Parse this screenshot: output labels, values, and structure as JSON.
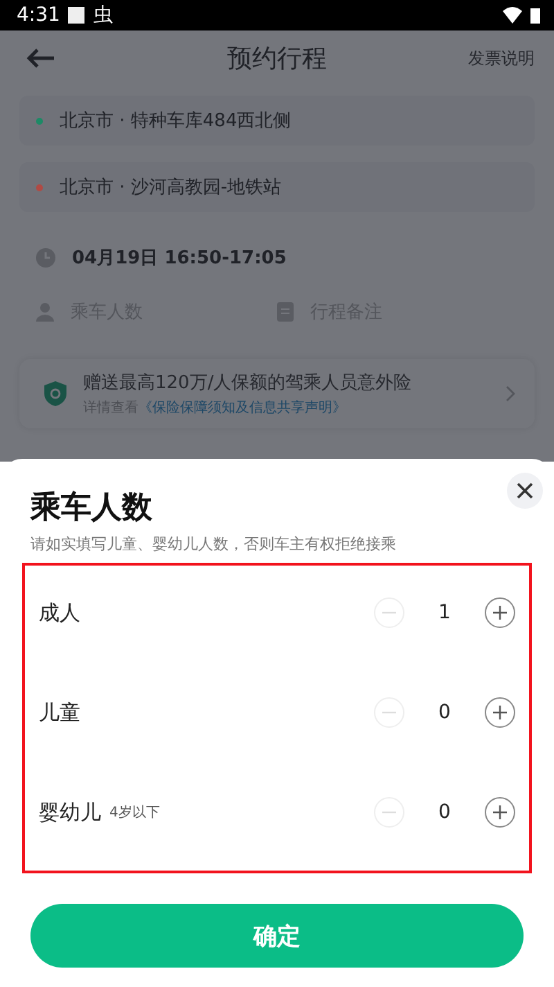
{
  "status_bar": {
    "time": "4:31",
    "notification": "虫"
  },
  "header": {
    "title": "预约行程",
    "action": "发票说明"
  },
  "route": [
    {
      "text": "北京市 · 特种车库484西北侧",
      "color": "#1d8a66"
    },
    {
      "text": "北京市 · 沙河高教园-地铁站",
      "color": "#b04a44"
    }
  ],
  "time": "04月19日 16:50-17:05",
  "fields": [
    {
      "placeholder": "乘车人数",
      "kind": "person"
    },
    {
      "placeholder": "行程备注",
      "kind": "note"
    }
  ],
  "insurance": {
    "title": "赠送最高120万/人保额的驾乘人员意外险",
    "detail": "详情查看",
    "link": "《保险保障须知及信息共享声明》"
  },
  "sheet": {
    "title": "乘车人数",
    "subtitle": "请如实填写儿童、婴幼儿人数，否则车主有权拒绝接乘",
    "rows": [
      {
        "label": "成人",
        "count": "1",
        "minus_disabled": true
      },
      {
        "label": "儿童",
        "count": "0",
        "minus_disabled": true
      },
      {
        "label": "婴幼儿",
        "note": "4岁以下",
        "count": "0",
        "minus_disabled": true
      }
    ],
    "confirm": "确定"
  }
}
